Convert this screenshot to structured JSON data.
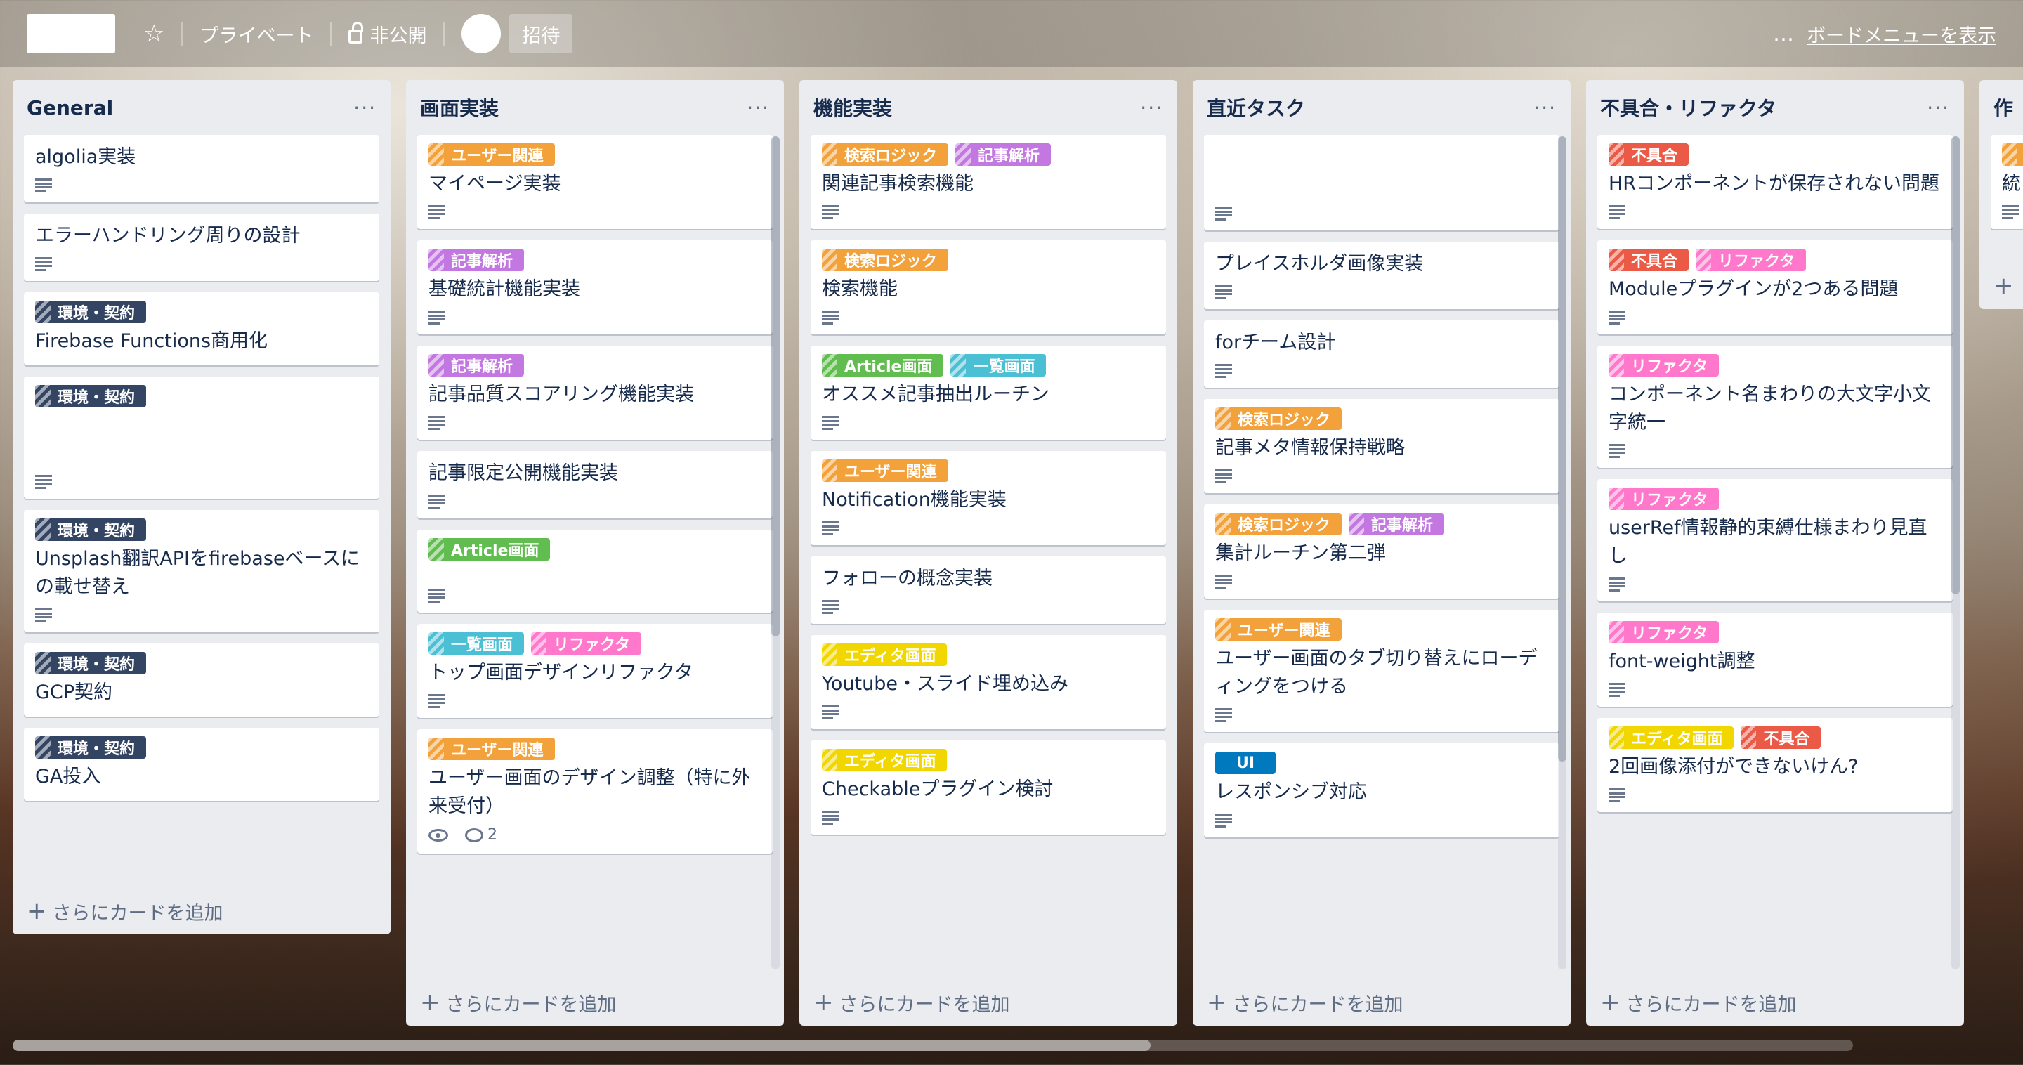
{
  "header": {
    "title": "",
    "visibility_team": "プライベート",
    "visibility_private": "非公開",
    "invite": "招待",
    "more_dots": "…",
    "show_menu": "ボードメニューを表示"
  },
  "colors": {
    "orange": "#f2a13b",
    "purple": "#c377e0",
    "green": "#61bd4f",
    "sky": "#4bbfd4",
    "navy": "#344563",
    "red": "#eb5a46",
    "pink": "#ff78cb",
    "yellow": "#f2d600",
    "blue": "#0079bf"
  },
  "add_card_label": "さらにカードを追加",
  "lists": [
    {
      "title": "General",
      "cards": [
        {
          "title": "algolia実装"
        },
        {
          "title": "エラーハンドリング周りの設計"
        },
        {
          "label1": "環境・契約",
          "title": "Firebase Functions商用化"
        },
        {
          "label1": "環境・契約",
          "title": ""
        },
        {
          "label1": "環境・契約",
          "title": "Unsplash翻訳APIをfirebaseベースにの載せ替え"
        },
        {
          "label1": "環境・契約",
          "title": "GCP契約"
        },
        {
          "label1": "環境・契約",
          "title": "GA投入"
        }
      ]
    },
    {
      "title": "画面実装",
      "cards": [
        {
          "label1": "ユーザー関連",
          "title": "マイページ実装"
        },
        {
          "label1": "記事解析",
          "title": "基礎統計機能実装"
        },
        {
          "label1": "記事解析",
          "title": "記事品質スコアリング機能実装"
        },
        {
          "title": "記事限定公開機能実装"
        },
        {
          "label1": "Article画面",
          "title": ""
        },
        {
          "label1": "一覧画面",
          "label2": "リファクタ",
          "title": "トップ画面デザインリファクタ"
        },
        {
          "label1": "ユーザー関連",
          "title": "ユーザー画面のデザイン調整（特に外来受付）",
          "comments": "2"
        }
      ]
    },
    {
      "title": "機能実装",
      "cards": [
        {
          "label1": "検索ロジック",
          "label2": "記事解析",
          "title": "関連記事検索機能"
        },
        {
          "label1": "検索ロジック",
          "title": "検索機能"
        },
        {
          "label1": "Article画面",
          "label2": "一覧画面",
          "title": "オススメ記事抽出ルーチン"
        },
        {
          "label1": "ユーザー関連",
          "title": "Notification機能実装"
        },
        {
          "title": "フォローの概念実装"
        },
        {
          "label1": "エディタ画面",
          "title": "Youtube・スライド埋め込み"
        },
        {
          "label1": "エディタ画面",
          "title": "Checkableプラグイン検討"
        }
      ]
    },
    {
      "title": "直近タスク",
      "cards": [
        {
          "title": ""
        },
        {
          "title": "プレイスホルダ画像実装"
        },
        {
          "title": "forチーム設計"
        },
        {
          "label1": "検索ロジック",
          "title": "記事メタ情報保持戦略"
        },
        {
          "label1": "検索ロジック",
          "label2": "記事解析",
          "title": "集計ルーチン第二弾"
        },
        {
          "label1": "ユーザー関連",
          "title": "ユーザー画面のタブ切り替えにローディングをつける"
        },
        {
          "label1": "UI",
          "title": "レスポンシブ対応"
        }
      ]
    },
    {
      "title": "不具合・リファクタ",
      "cards": [
        {
          "label1": "不具合",
          "title": "HRコンポーネントが保存されない問題"
        },
        {
          "label1": "不具合",
          "label2": "リファクタ",
          "title": "Moduleプラグインが2つある問題"
        },
        {
          "label1": "リファクタ",
          "title": "コンポーネント名まわりの大文字小文字統一"
        },
        {
          "label1": "リファクタ",
          "title": "userRef情報静的束縛仕様まわり見直し"
        },
        {
          "label1": "リファクタ",
          "title": "font-weight調整"
        },
        {
          "label1": "エディタ画面",
          "label2": "不具合",
          "title": "2回画像添付ができないけん?"
        }
      ]
    },
    {
      "title": "作",
      "cards": [
        {
          "title": "統"
        }
      ]
    }
  ]
}
